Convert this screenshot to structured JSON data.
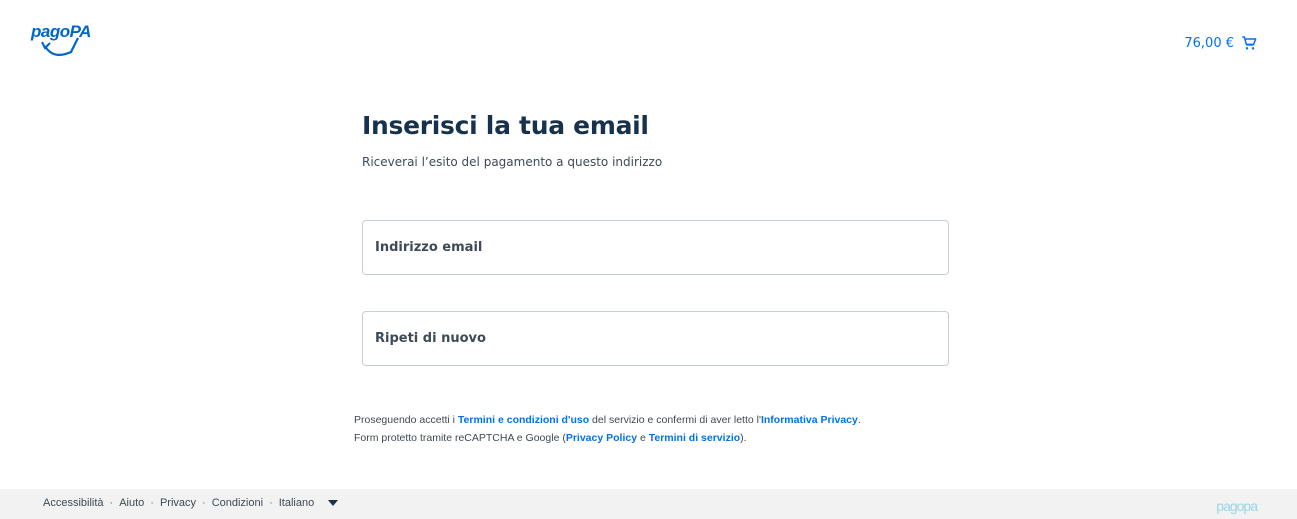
{
  "header": {
    "logo_text": "pagoPA",
    "cart_amount": "76,00 €",
    "cart_icon": "shopping-cart-icon"
  },
  "main": {
    "title": "Inserisci la tua email",
    "subtitle": "Riceverai l’esito del pagamento a questo indirizzo",
    "email_field": {
      "placeholder": "Indirizzo email",
      "value": ""
    },
    "repeat_field": {
      "placeholder": "Ripeti di nuovo",
      "value": ""
    }
  },
  "legal": {
    "line1_pre": "Proseguendo accetti i ",
    "terms_link": "Termini e condizioni d'uso",
    "line1_mid": " del servizio e confermi di aver letto l'",
    "privacy_link": "Informativa Privacy",
    "line1_post": ".",
    "line2_pre": "Form protetto tramite reCAPTCHA e Google (",
    "google_privacy_link": "Privacy Policy",
    "line2_mid": " e ",
    "google_terms_link": "Termini di servizio",
    "line2_post": ")."
  },
  "footer": {
    "links": [
      "Accessibilità",
      "Aiuto",
      "Privacy",
      "Condizioni"
    ],
    "language": "Italiano",
    "separator": "·",
    "brand": "pagopa"
  },
  "colors": {
    "accent": "#0073e6",
    "text": "#17324d",
    "border": "#c7cfd6",
    "footer_bg": "#f2f2f2"
  }
}
